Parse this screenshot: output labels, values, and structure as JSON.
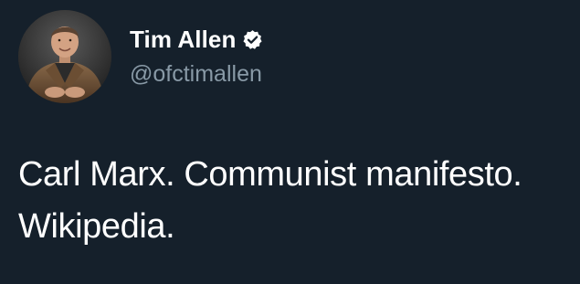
{
  "tweet": {
    "author": {
      "display_name": "Tim Allen",
      "handle": "@ofctimallen",
      "verified": true,
      "avatar_icon": "profile-photo"
    },
    "text_lines": [
      "Carl Marx. Communist manifesto.",
      "Wikipedia."
    ]
  },
  "colors": {
    "background": "#15202b",
    "text": "#ffffff",
    "secondary_text": "#8899a6"
  }
}
